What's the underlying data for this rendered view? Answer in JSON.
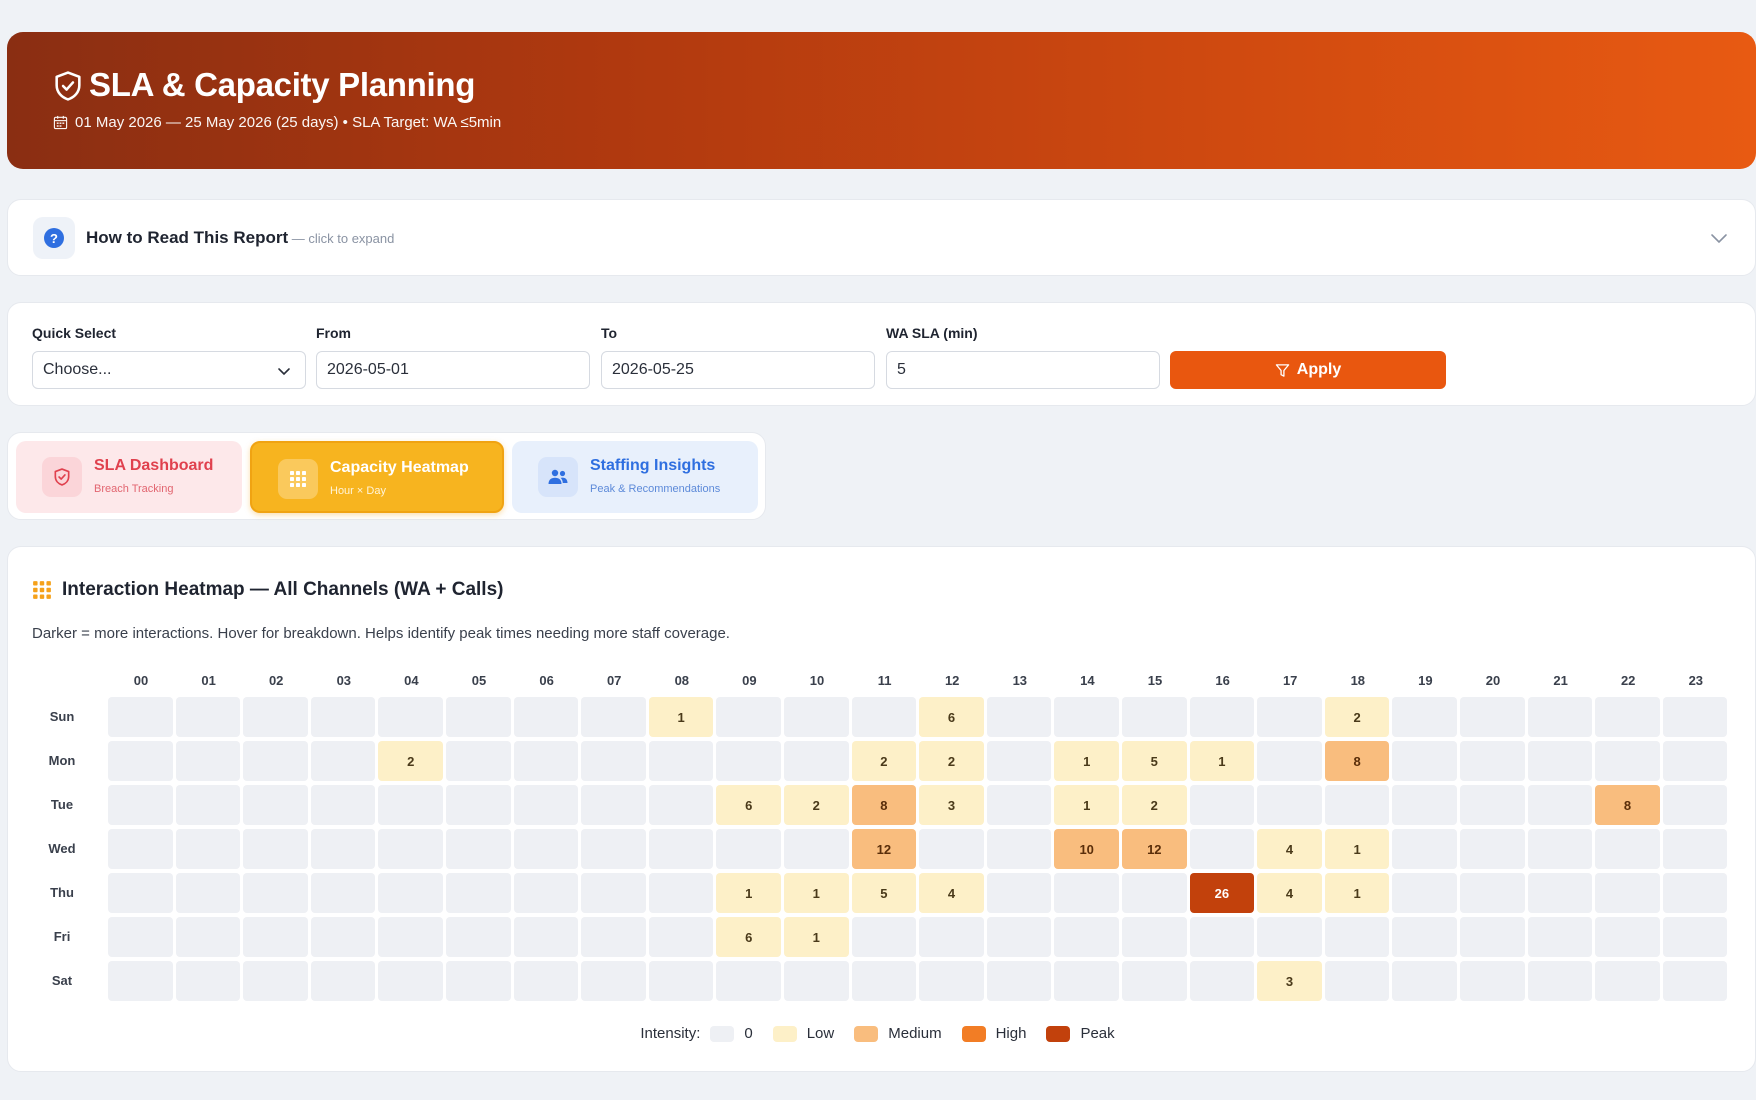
{
  "header": {
    "title": "SLA & Capacity Planning",
    "subtitle": "01 May 2026 — 25 May 2026 (25 days) • SLA Target: WA ≤5min"
  },
  "howto": {
    "title": "How to Read This Report",
    "hint": " — click to expand"
  },
  "filters": {
    "quick_select_label": "Quick Select",
    "quick_select_value": "Choose...",
    "from_label": "From",
    "from_value": "2026-05-01",
    "to_label": "To",
    "to_value": "2026-05-25",
    "sla_label": "WA SLA (min)",
    "sla_value": "5",
    "apply_label": "Apply"
  },
  "tabs": [
    {
      "title": "SLA Dashboard",
      "sub": "Breach Tracking"
    },
    {
      "title": "Capacity Heatmap",
      "sub": "Hour × Day"
    },
    {
      "title": "Staffing Insights",
      "sub": "Peak & Recommendations"
    }
  ],
  "heatmap": {
    "title": "Interaction Heatmap — All Channels (WA + Calls)",
    "description": "Darker = more interactions. Hover for breakdown. Helps identify peak times needing more staff coverage.",
    "legend_label": "Intensity:",
    "legend": [
      {
        "label": "0",
        "color": "#eef0f4"
      },
      {
        "label": "Low",
        "color": "#fdf0c8"
      },
      {
        "label": "Medium",
        "color": "#f9bd7e"
      },
      {
        "label": "High",
        "color": "#f27d25"
      },
      {
        "label": "Peak",
        "color": "#c2410c"
      }
    ]
  },
  "chart_data": {
    "type": "heatmap",
    "title": "Interaction Heatmap — All Channels (WA + Calls)",
    "x": [
      "00",
      "01",
      "02",
      "03",
      "04",
      "05",
      "06",
      "07",
      "08",
      "09",
      "10",
      "11",
      "12",
      "13",
      "14",
      "15",
      "16",
      "17",
      "18",
      "19",
      "20",
      "21",
      "22",
      "23"
    ],
    "y": [
      "Sun",
      "Mon",
      "Tue",
      "Wed",
      "Thu",
      "Fri",
      "Sat"
    ],
    "values": [
      [
        0,
        0,
        0,
        0,
        0,
        0,
        0,
        0,
        1,
        0,
        0,
        0,
        6,
        0,
        0,
        0,
        0,
        0,
        2,
        0,
        0,
        0,
        0,
        0
      ],
      [
        0,
        0,
        0,
        0,
        2,
        0,
        0,
        0,
        0,
        0,
        0,
        2,
        2,
        0,
        1,
        5,
        1,
        0,
        8,
        0,
        0,
        0,
        0,
        0
      ],
      [
        0,
        0,
        0,
        0,
        0,
        0,
        0,
        0,
        0,
        6,
        2,
        8,
        3,
        0,
        1,
        2,
        0,
        0,
        0,
        0,
        0,
        0,
        8,
        0
      ],
      [
        0,
        0,
        0,
        0,
        0,
        0,
        0,
        0,
        0,
        0,
        0,
        12,
        0,
        0,
        10,
        12,
        0,
        4,
        1,
        0,
        0,
        0,
        0,
        0
      ],
      [
        0,
        0,
        0,
        0,
        0,
        0,
        0,
        0,
        0,
        1,
        1,
        5,
        4,
        0,
        0,
        0,
        26,
        4,
        1,
        0,
        0,
        0,
        0,
        0
      ],
      [
        0,
        0,
        0,
        0,
        0,
        0,
        0,
        0,
        0,
        6,
        1,
        0,
        0,
        0,
        0,
        0,
        0,
        0,
        0,
        0,
        0,
        0,
        0,
        0
      ],
      [
        0,
        0,
        0,
        0,
        0,
        0,
        0,
        0,
        0,
        0,
        0,
        0,
        0,
        0,
        0,
        0,
        0,
        3,
        0,
        0,
        0,
        0,
        0,
        0
      ]
    ]
  }
}
